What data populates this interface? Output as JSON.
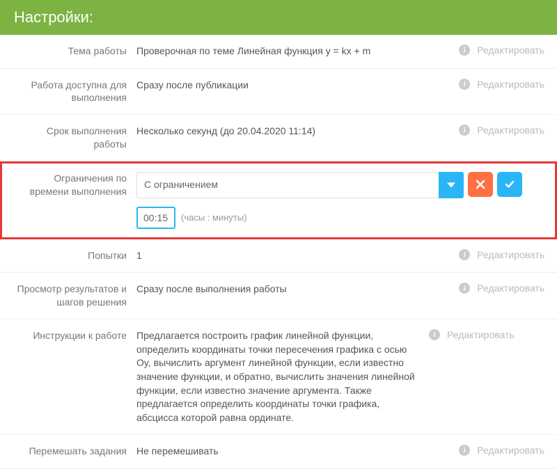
{
  "header": {
    "title": "Настройки:"
  },
  "edit_label": "Редактировать",
  "rows": {
    "topic": {
      "label": "Тема работы",
      "value": "Проверочная по теме Линейная функция y = kx + m"
    },
    "availability": {
      "label": "Работа доступна для выполнения",
      "value": "Сразу после публикации"
    },
    "deadline": {
      "label": "Срок выполнения работы",
      "value": "Несколько секунд (до 20.04.2020 11:14)"
    },
    "time_limit": {
      "label": "Ограничения по времени выполнения",
      "select_value": "С ограничением",
      "time_value": "00:15",
      "time_hint": "(часы : минуты)"
    },
    "attempts": {
      "label": "Попытки",
      "value": "1"
    },
    "results_view": {
      "label": "Просмотр результатов и шагов решения",
      "value": "Сразу после выполнения работы"
    },
    "instructions": {
      "label": "Инструкции к работе",
      "value": "Предлагается построить график линейной функции, определить координаты точки пересечения графика с осью Oy, вычислить аргумент линейной функции, если известно значение функции, и обратно, вычислить значения линейной функции, если известно значение аргумента. Также предлагается определить координаты точки графика, абсцисса которой равна ординате."
    },
    "shuffle": {
      "label": "Перемешать задания",
      "value": "Не перемешивать"
    }
  }
}
